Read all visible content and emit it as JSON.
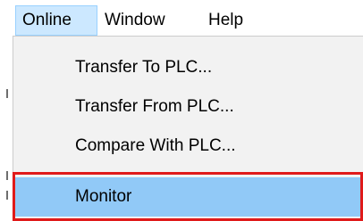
{
  "menubar": {
    "items": [
      {
        "label": "Online"
      },
      {
        "label": "Window"
      },
      {
        "label": "Help"
      }
    ]
  },
  "dropdown": {
    "items": [
      {
        "label": "Transfer To PLC..."
      },
      {
        "label": "Transfer From PLC..."
      },
      {
        "label": "Compare With PLC..."
      },
      {
        "label": "Monitor"
      }
    ]
  },
  "colors": {
    "menubar_active_bg": "#cce8ff",
    "dropdown_bg": "#f2f2f2",
    "hovered_item_bg": "#91c9f7",
    "callout_border": "#e01a1a"
  }
}
